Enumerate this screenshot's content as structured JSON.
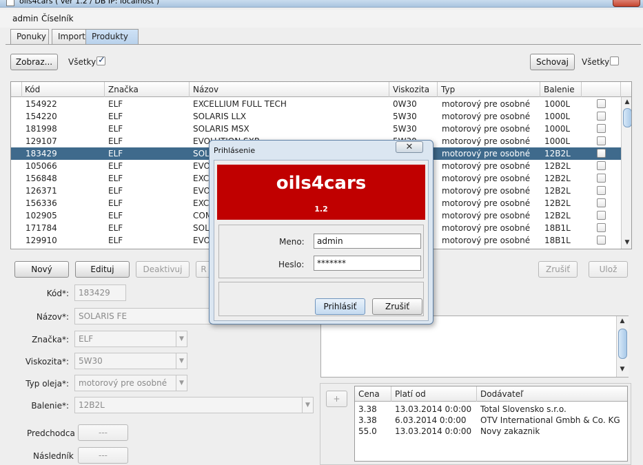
{
  "window": {
    "title": "oils4cars ( ver 1.2 / DB IP: localhost )"
  },
  "menu": {
    "items": [
      "admin",
      "Číselník"
    ]
  },
  "tabs": [
    "Ponuky",
    "Import",
    "Produkty"
  ],
  "active_tab": "Produkty",
  "toolbar": {
    "show_button": "Zobraz...",
    "all_label_left": "Všetky",
    "all_left_checked": true,
    "hide_button": "Schovaj",
    "all_label_right": "Všetky",
    "all_right_checked": false
  },
  "products_table": {
    "columns": [
      "Kód",
      "Značka",
      "Názov",
      "Viskozita",
      "Typ",
      "Balenie",
      ""
    ],
    "selected_row_index": 4,
    "rows": [
      {
        "kod": "154922",
        "znacka": "ELF",
        "nazov": "EXCELLIUM FULL TECH",
        "viskozita": "0W30",
        "typ": "motorový pre osobné",
        "balenie": "1000L",
        "checked": false
      },
      {
        "kod": "154220",
        "znacka": "ELF",
        "nazov": "SOLARIS LLX",
        "viskozita": "5W30",
        "typ": "motorový pre osobné",
        "balenie": "1000L",
        "checked": false
      },
      {
        "kod": "181998",
        "znacka": "ELF",
        "nazov": "SOLARIS MSX",
        "viskozita": "5W30",
        "typ": "motorový pre osobné",
        "balenie": "1000L",
        "checked": false
      },
      {
        "kod": "129107",
        "znacka": "ELF",
        "nazov": "EVOLUTION SXR",
        "viskozita": "5W30",
        "typ": "motorový pre osobné",
        "balenie": "1000L",
        "checked": false
      },
      {
        "kod": "183429",
        "znacka": "ELF",
        "nazov": "SOLARIS FE",
        "viskozita": "5W30",
        "typ": "motorový pre osobné",
        "balenie": "12B2L",
        "checked": false
      },
      {
        "kod": "105066",
        "znacka": "ELF",
        "nazov": "EVO",
        "viskozita": "",
        "typ": "motorový pre osobné",
        "balenie": "12B2L",
        "checked": false
      },
      {
        "kod": "156848",
        "znacka": "ELF",
        "nazov": "EXC",
        "viskozita": "",
        "typ": "motorový pre osobné",
        "balenie": "12B2L",
        "checked": false
      },
      {
        "kod": "126371",
        "znacka": "ELF",
        "nazov": "EVO",
        "viskozita": "",
        "typ": "motorový pre osobné",
        "balenie": "12B2L",
        "checked": false
      },
      {
        "kod": "156336",
        "znacka": "ELF",
        "nazov": "EXC",
        "viskozita": "",
        "typ": "motorový pre osobné",
        "balenie": "12B2L",
        "checked": false
      },
      {
        "kod": "102905",
        "znacka": "ELF",
        "nazov": "COM",
        "viskozita": "",
        "typ": "motorový pre osobné",
        "balenie": "12B2L",
        "checked": false
      },
      {
        "kod": "171784",
        "znacka": "ELF",
        "nazov": "SOL",
        "viskozita": "",
        "typ": "motorový pre osobné",
        "balenie": "18B1L",
        "checked": false
      },
      {
        "kod": "129910",
        "znacka": "ELF",
        "nazov": "EVO",
        "viskozita": "",
        "typ": "motorový pre osobné",
        "balenie": "18B1L",
        "checked": false
      }
    ]
  },
  "actions": {
    "new": "Nový",
    "edit": "Edituj",
    "deactivate": "Deaktivuj",
    "partial": "R",
    "cancel": "Zrušiť",
    "save": "Ulož"
  },
  "form": {
    "kod_label": "Kód*:",
    "kod_value": "183429",
    "nazov_label": "Názov*:",
    "nazov_value": "SOLARIS FE",
    "znacka_label": "Značka*:",
    "znacka_value": "ELF",
    "viskozita_label": "Viskozita*:",
    "viskozita_value": "5W30",
    "typ_label": "Typ oleja*:",
    "typ_value": "motorový pre osobné",
    "balenie_label": "Balenie*:",
    "balenie_value": "12B2L",
    "predchodca_label": "Predchodca",
    "predchodca_value": "---",
    "naslednik_label": "Následník",
    "naslednik_value": "---"
  },
  "prices": {
    "add_button": "+",
    "columns": [
      "Cena",
      "Platí od",
      "Dodávateľ"
    ],
    "rows": [
      {
        "cena": "3.38",
        "plati_od": "13.03.2014 0:0:00",
        "dodavatel": "Total Slovensko s.r.o."
      },
      {
        "cena": "3.38",
        "plati_od": "6.03.2014 0:0:00",
        "dodavatel": "OTV International Gmbh & Co. KG"
      },
      {
        "cena": "55.0",
        "plati_od": "13.03.2014 0:0:00",
        "dodavatel": "Novy zakaznik"
      }
    ]
  },
  "login_dialog": {
    "title": "Prihlásenie",
    "close_glyph": "✕",
    "app_name": "oils4cars",
    "version": "1.2",
    "username_label": "Meno:",
    "username_value": "admin",
    "password_label": "Heslo:",
    "password_value": "*******",
    "login_button": "Prihlásiť",
    "cancel_button": "Zrušiť",
    "banner_color": "#c00000"
  },
  "colors": {
    "selection": "#3f6a8c",
    "accent": "#b9d2ec"
  }
}
